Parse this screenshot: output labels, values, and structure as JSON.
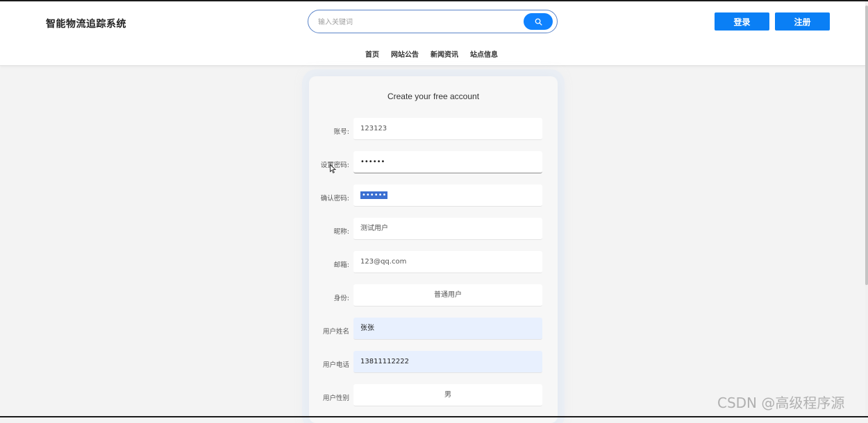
{
  "header": {
    "logo": "智能物流追踪系统",
    "search_placeholder": "输入关键词",
    "login_label": "登录",
    "register_label": "注册"
  },
  "nav": [
    "首页",
    "网站公告",
    "新闻资讯",
    "站点信息"
  ],
  "form": {
    "title": "Create your free account",
    "fields": [
      {
        "label": "账号:",
        "value": "123123"
      },
      {
        "label": "设置密码:",
        "value": "••••••"
      },
      {
        "label": "确认密码:",
        "value": "••••••"
      },
      {
        "label": "昵称:",
        "value": "测试用户"
      },
      {
        "label": "邮箱:",
        "value": "123@qq.com"
      },
      {
        "label": "身份:",
        "value": "普通用户"
      },
      {
        "label": "用户姓名",
        "value": "张张"
      },
      {
        "label": "用户电话",
        "value": "13811112222"
      },
      {
        "label": "用户性别",
        "value": "男"
      }
    ]
  },
  "watermark": "CSDN @高级程序源"
}
